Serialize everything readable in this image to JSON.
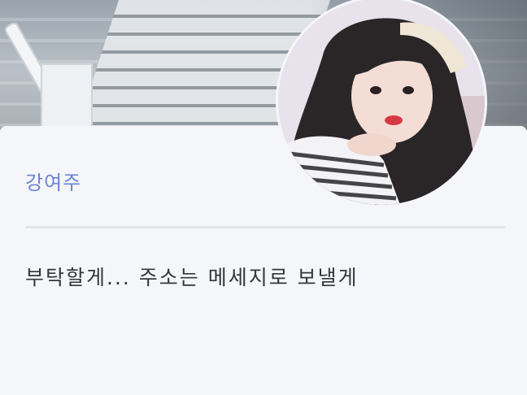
{
  "profile": {
    "name": "강여주",
    "avatar_icon": "profile-photo"
  },
  "message": {
    "text": "부탁할게... 주소는 메세지로 보낼게"
  },
  "colors": {
    "name": "#6a83d6",
    "message_text": "#33363d",
    "card_background": "#f5f6f9",
    "divider": "#e2e4ea"
  }
}
